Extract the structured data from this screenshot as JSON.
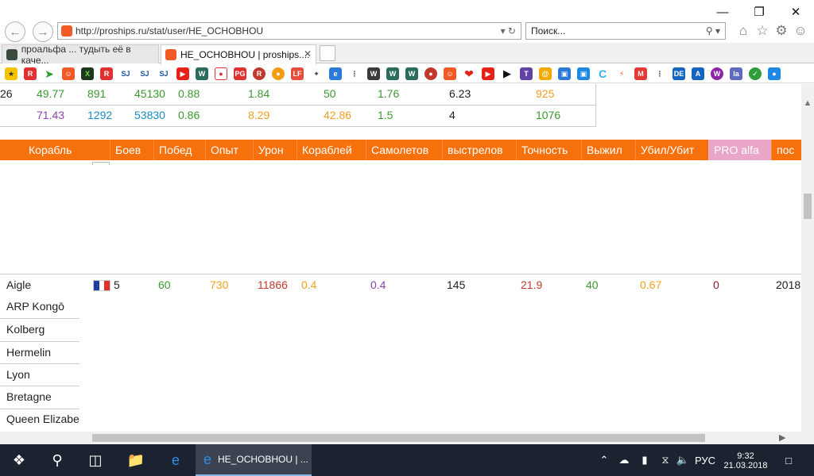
{
  "browser": {
    "url": "http://proships.ru/stat/user/HE_OCHOBHOU",
    "search_placeholder": "Поиск...",
    "tabs": [
      {
        "label": "проальфа ... тудыть её в каче..."
      },
      {
        "label": "HE_OCHOBHOU | proships...."
      }
    ]
  },
  "summary_rows": [
    [
      "26",
      "49.77",
      "891",
      "45130",
      "0.88",
      "1.84",
      "50",
      "1.76",
      "6.23",
      "925"
    ],
    [
      "",
      "71.43",
      "1292",
      "53830",
      "0.86",
      "8.29",
      "42.86",
      "1.5",
      "4",
      "1076"
    ]
  ],
  "table": {
    "headers": [
      "Корабль",
      "Боев",
      "Побед",
      "Опыт",
      "Урон",
      "Кораблей",
      "Самолетов",
      "выстрелов",
      "Точность",
      "Выжил",
      "Убил/Убит",
      "PRO alfa",
      "пос"
    ],
    "aigle_row": {
      "name": "Aigle",
      "tier": "5",
      "wins": "60",
      "xp": "730",
      "damage": "11866",
      "ships": "0.4",
      "planes": "0.4",
      "shots": "145",
      "accuracy": "21.9",
      "survived": "40",
      "kd": "0.67",
      "pro": "0",
      "last": "2018"
    },
    "ship_list": [
      "ARP Kongō",
      "Kolberg",
      "Hermelin",
      "Lyon",
      "Bretagne",
      "Queen Elizabe"
    ]
  },
  "taskbar": {
    "active_window": "HE_OCHOBHOU | ...",
    "lang": "РУС",
    "time": "9:32",
    "date": "21.03.2018"
  },
  "colors": {
    "header_orange": "#f6700c",
    "pro_header": "#e9a6c8",
    "taskbar": "#1c2330"
  }
}
